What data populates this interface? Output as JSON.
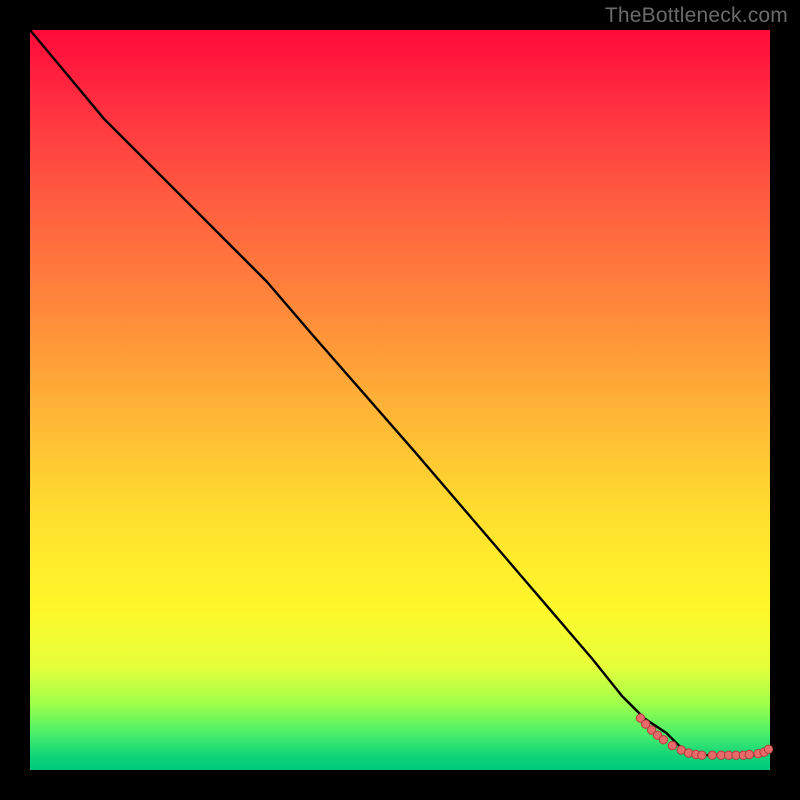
{
  "credit": "TheBottleneck.com",
  "colors": {
    "page_bg": "#000000",
    "credit_text": "#6b6b6b",
    "curve": "#000000",
    "marker_fill": "#e86a6a",
    "marker_stroke": "#b43e3e",
    "gradient_top": "#ff0a3a",
    "gradient_mid": "#fff82a",
    "gradient_bot": "#00c97c"
  },
  "chart_data": {
    "type": "line",
    "title": "",
    "xlabel": "",
    "ylabel": "",
    "xlim": [
      0,
      100
    ],
    "ylim": [
      0,
      100
    ],
    "grid": false,
    "legend": false,
    "series": [
      {
        "name": "curve",
        "x": [
          0,
          5,
          10,
          15,
          20,
          25,
          28,
          32,
          38,
          45,
          52,
          58,
          64,
          70,
          76,
          80,
          83,
          86,
          88,
          90,
          92,
          94,
          96,
          98,
          100
        ],
        "y": [
          100,
          94,
          88,
          83,
          78,
          73,
          70,
          66,
          59,
          51,
          43,
          36,
          29,
          22,
          15,
          10,
          7,
          5,
          3,
          2,
          2,
          2,
          2,
          2,
          3
        ]
      }
    ],
    "markers": {
      "name": "bottom-cluster",
      "x": [
        82.5,
        83.2,
        84.0,
        84.8,
        85.6,
        86.8,
        88.0,
        89.0,
        90.0,
        90.8,
        92.2,
        93.4,
        94.4,
        95.4,
        96.4,
        97.2,
        98.4,
        99.2,
        99.8
      ],
      "y": [
        7.0,
        6.2,
        5.4,
        4.7,
        4.1,
        3.3,
        2.7,
        2.3,
        2.1,
        2.0,
        2.0,
        2.0,
        2.0,
        2.0,
        2.0,
        2.1,
        2.2,
        2.4,
        2.8
      ]
    }
  }
}
